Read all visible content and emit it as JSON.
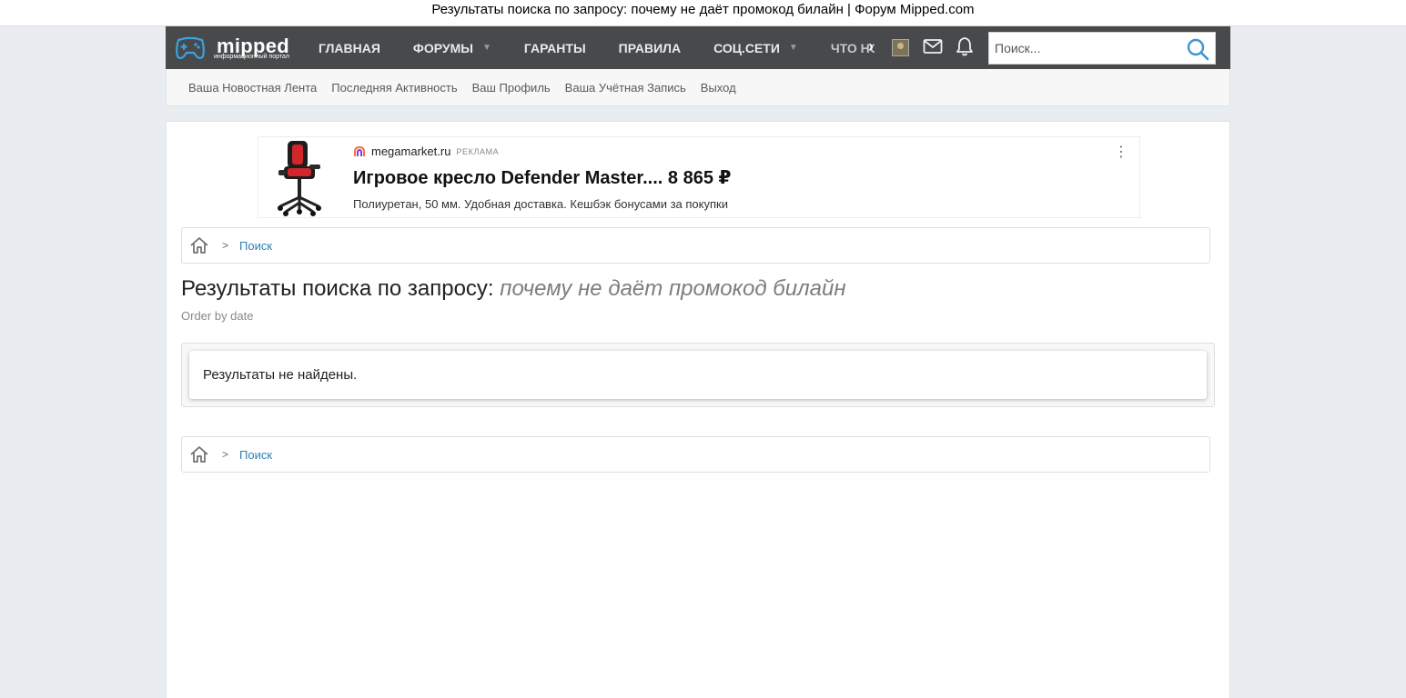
{
  "window": {
    "title": "Результаты поиска по запросу: почему не даёт промокод билайн | Форум Mipped.com"
  },
  "logo": {
    "word": "mipped",
    "tagline": "информационный портал"
  },
  "nav": {
    "items": [
      {
        "label": "ГЛАВНАЯ"
      },
      {
        "label": "ФОРУМЫ"
      },
      {
        "label": "ГАРАНТЫ"
      },
      {
        "label": "ПРАВИЛА"
      },
      {
        "label": "СОЦ.СЕТИ"
      },
      {
        "label": "ЧТО НОВОГО"
      }
    ]
  },
  "search": {
    "placeholder": "Поиск..."
  },
  "subnav": {
    "items": [
      {
        "label": "Ваша Новостная Лента"
      },
      {
        "label": "Последняя Активность"
      },
      {
        "label": "Ваш Профиль"
      },
      {
        "label": "Ваша Учётная Запись"
      },
      {
        "label": "Выход"
      }
    ]
  },
  "ad": {
    "domain": "megamarket.ru",
    "tag": "РЕКЛАМА",
    "headline": "Игровое кресло Defender Master.... 8 865 ₽",
    "text": "Полиуретан, 50 мм. Удобная доставка. Кешбэк бонусами за покупки"
  },
  "breadcrumb": {
    "item": "Поиск"
  },
  "page": {
    "title_prefix": "Результаты поиска по запросу:",
    "query": "почему не даёт промокод билайн",
    "order": "Order by date",
    "no_results": "Результаты не найдены."
  },
  "colors": {
    "topbar": "#47494b",
    "accent": "#2f7fb6",
    "logo_icon": "#3ba3dd"
  }
}
